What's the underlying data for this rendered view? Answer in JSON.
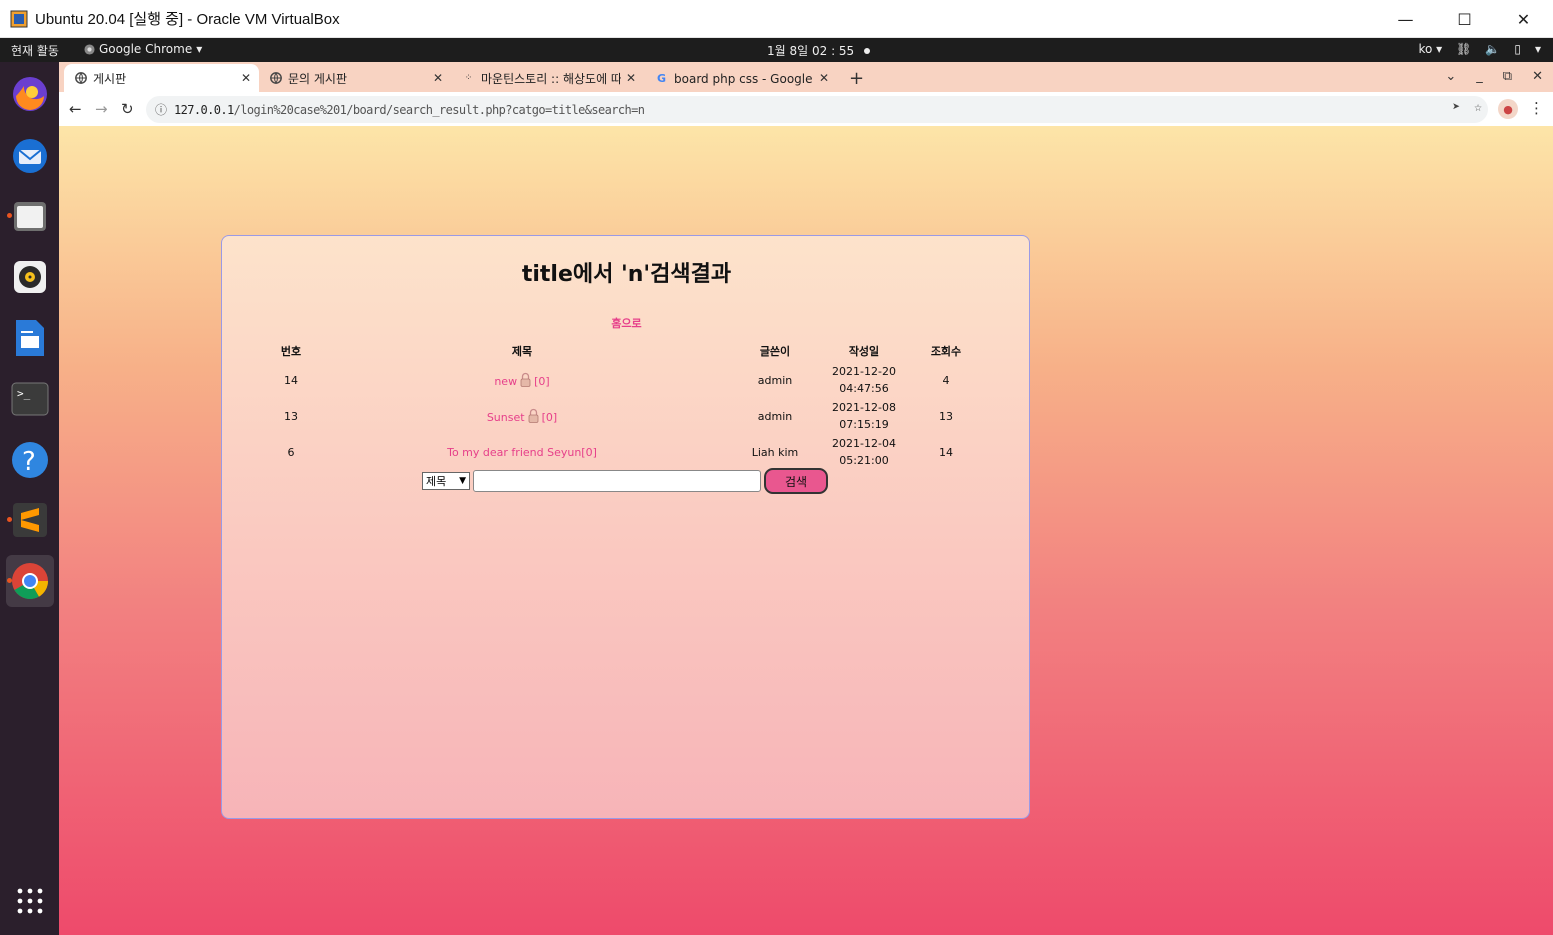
{
  "window": {
    "title": "Ubuntu 20.04 [실행 중] - Oracle VM VirtualBox",
    "minimize": "—",
    "maximize": "☐",
    "close": "✕"
  },
  "ubuntu_panel": {
    "activities": "현재 활동",
    "app_menu": "Google Chrome",
    "clock": "1월 8일  02 : 55",
    "input_method": "ko",
    "accent": "#e95420"
  },
  "dock": {
    "items": [
      "firefox-icon",
      "thunderbird-icon",
      "files-icon",
      "rhythmbox-icon",
      "writer-icon",
      "terminal-icon",
      "help-icon",
      "sublime-icon",
      "chrome-icon",
      "app-grid-icon"
    ]
  },
  "chrome": {
    "tabs": [
      {
        "label": "게시판",
        "icon": "globe-icon",
        "active": true
      },
      {
        "label": "문의 게시판",
        "icon": "globe-icon",
        "active": false
      },
      {
        "label": "마운틴스토리 :: 해상도에 따",
        "icon": "tistory-icon",
        "active": false
      },
      {
        "label": "board php css - Google 검",
        "icon": "google-icon",
        "active": false
      }
    ],
    "new_tab": "+",
    "url_host": "127.0.0.1",
    "url_path": "/login%20case%201/board/search_result.php?catgo=title&search=n"
  },
  "page": {
    "title": "title에서 'n'검색결과",
    "home_link": "홈으로",
    "columns": {
      "no": "번호",
      "title": "제목",
      "writer": "글쓴이",
      "date": "작성일",
      "hit": "조회수"
    },
    "rows": [
      {
        "no": "14",
        "title": "new",
        "comments": "[0]",
        "locked": true,
        "writer": "admin",
        "date": "2021-12-20",
        "time": "04:47:56",
        "hit": "4"
      },
      {
        "no": "13",
        "title": "Sunset",
        "comments": "[0]",
        "locked": true,
        "writer": "admin",
        "date": "2021-12-08",
        "time": "07:15:19",
        "hit": "13"
      },
      {
        "no": "6",
        "title": "To my dear friend Seyun",
        "comments": "[0]",
        "locked": false,
        "writer": "Liah kim",
        "date": "2021-12-04",
        "time": "05:21:00",
        "hit": "14"
      }
    ],
    "search": {
      "select_value": "제목",
      "input_value": "",
      "button_label": "검색"
    },
    "link_color": "#e63f8a",
    "button_color": "#e9578f"
  }
}
